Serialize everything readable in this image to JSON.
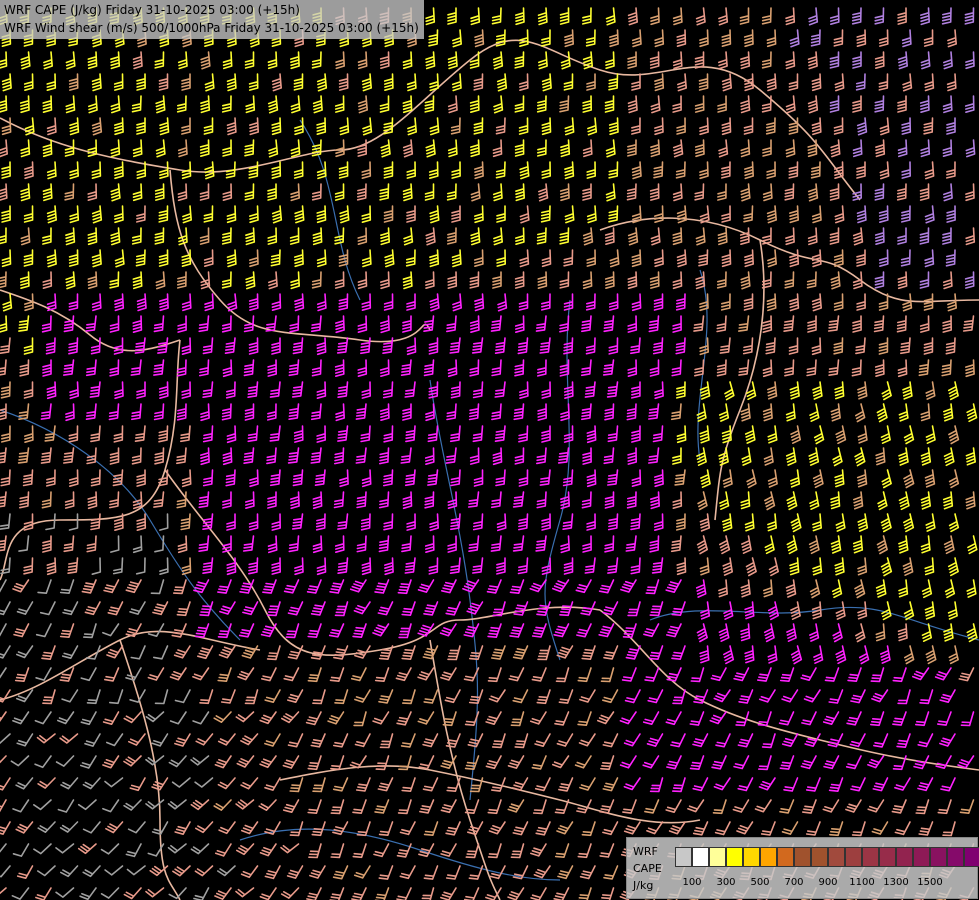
{
  "header": {
    "title_line1": "WRF CAPE (J/kg) Friday 31-10-2025 03:00 (+15h)",
    "title_line2": "WRF Wind shear (m/s) 500/1000hPa Friday 31-10-2025 03:00 (+15h)"
  },
  "legend": {
    "model": "WRF",
    "field": "CAPE",
    "unit": "J/kg",
    "swatch_colors": [
      "#c8c8c8",
      "#ffffff",
      "#ffff99",
      "#ffff00",
      "#ffd700",
      "#ffa500",
      "#d2691e",
      "#a0522d",
      "#a0522d",
      "#a14a3d",
      "#9d3f3f",
      "#9b3545",
      "#972c4a",
      "#92234f",
      "#8e1a56",
      "#891260",
      "#850a6a",
      "#800070"
    ],
    "ticks": [
      "100",
      "300",
      "500",
      "700",
      "900",
      "1100",
      "1300",
      "1500"
    ]
  },
  "map": {
    "background": "#000000",
    "barb_colors": {
      "gray": "#a0a0a0",
      "salmon": "#e89a8a",
      "orange": "#d9a070",
      "yellow": "#ffff30",
      "magenta": "#ff22ff",
      "lavender": "#b080e0"
    },
    "border_color": "#e8b8a0",
    "river_color": "#3a6fb0"
  }
}
